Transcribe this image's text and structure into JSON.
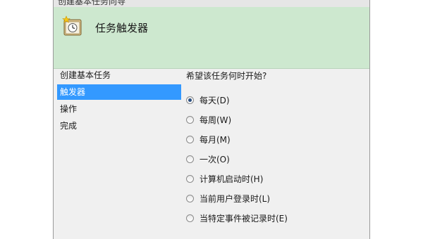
{
  "window": {
    "title": "创建基本任务向导"
  },
  "header": {
    "icon": "task-scheduler-clock-icon",
    "title": "任务触发器"
  },
  "steps": {
    "items": [
      {
        "label": "创建基本任务",
        "selected": false
      },
      {
        "label": "触发器",
        "selected": true
      },
      {
        "label": "操作",
        "selected": false
      },
      {
        "label": "完成",
        "selected": false
      }
    ]
  },
  "content": {
    "question": "希望该任务何时开始?",
    "options": [
      {
        "label": "每天(D)",
        "checked": true
      },
      {
        "label": "每周(W)",
        "checked": false
      },
      {
        "label": "每月(M)",
        "checked": false
      },
      {
        "label": "一次(O)",
        "checked": false
      },
      {
        "label": "计算机启动时(H)",
        "checked": false
      },
      {
        "label": "当前用户登录时(L)",
        "checked": false
      },
      {
        "label": "当特定事件被记录时(E)",
        "checked": false
      }
    ]
  },
  "colors": {
    "header_bg": "#cde8cf",
    "selected_step_bg": "#3399ff",
    "window_bg": "#f0f0f0"
  }
}
